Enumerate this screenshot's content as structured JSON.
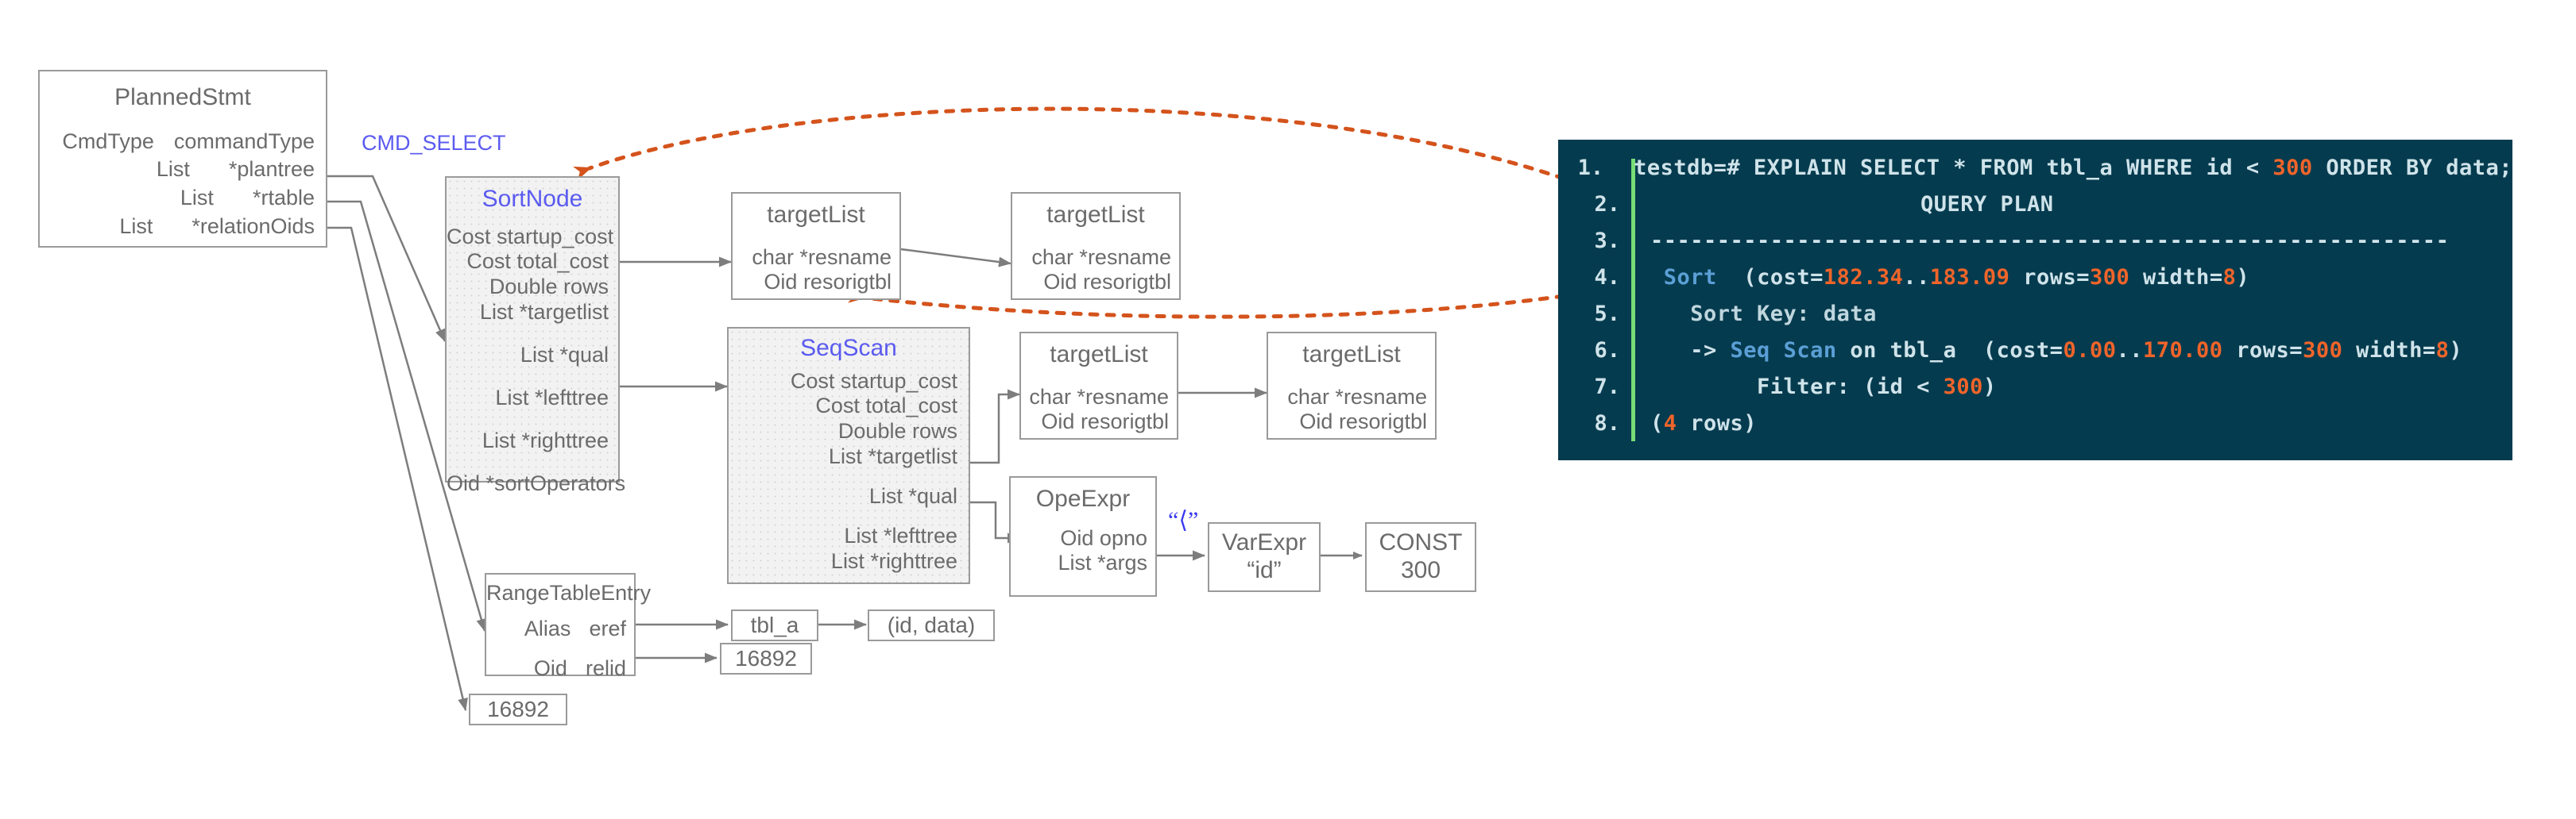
{
  "diagram": {
    "cmd_label": "CMD_SELECT",
    "operator_label": "“⟨”"
  },
  "planned_stmt": {
    "title": "PlannedStmt",
    "fields": [
      {
        "type": "CmdType",
        "name": "commandType"
      },
      {
        "type": "List",
        "name": "*plantree"
      },
      {
        "type": "List",
        "name": "*rtable"
      },
      {
        "type": "List",
        "name": "*relationOids"
      }
    ]
  },
  "sort_node": {
    "title": "SortNode",
    "fields": [
      "Cost startup_cost",
      "Cost total_cost",
      "Double rows",
      "List *targetlist",
      "List *qual",
      "List *lefttree",
      "List *righttree",
      "Oid *sortOperators"
    ]
  },
  "seq_scan": {
    "title": "SeqScan",
    "fields": [
      "Cost startup_cost",
      "Cost total_cost",
      "Double rows",
      "List *targetlist",
      "List *qual",
      "List *lefttree",
      "List *righttree"
    ]
  },
  "target_lists": [
    {
      "title": "targetList",
      "fields": [
        "char *resname",
        "Oid resorigtbl"
      ]
    },
    {
      "title": "targetList",
      "fields": [
        "char *resname",
        "Oid resorigtbl"
      ]
    },
    {
      "title": "targetList",
      "fields": [
        "char *resname",
        "Oid resorigtbl"
      ]
    },
    {
      "title": "targetList",
      "fields": [
        "char *resname",
        "Oid resorigtbl"
      ]
    }
  ],
  "ope_expr": {
    "title": "OpeExpr",
    "fields": [
      "Oid opno",
      "List *args"
    ]
  },
  "var_expr": {
    "title": "VarExpr",
    "value": "“id”"
  },
  "const_node": {
    "title": "CONST",
    "value": "300"
  },
  "range_table_entry": {
    "title": "RangeTableEntry",
    "fields": [
      {
        "type": "Alias",
        "name": "eref"
      },
      {
        "type": "Oid",
        "name": "relid"
      }
    ]
  },
  "leaf_values": {
    "table_name": "tbl_a",
    "columns": "(id, data)",
    "relid_oid": "16892",
    "relation_oid": "16892"
  },
  "terminal": {
    "lines": [
      {
        "num": "1.",
        "segments": [
          {
            "t": "testdb=# EXPLAIN SELECT * FROM tbl_a WHERE id < ",
            "c": "plain"
          },
          {
            "t": "300",
            "c": "num"
          },
          {
            "t": " ORDER BY data;",
            "c": "plain"
          }
        ]
      },
      {
        "num": "2.",
        "indent": 340,
        "segments": [
          {
            "t": "QUERY PLAN",
            "c": "plain"
          }
        ]
      },
      {
        "num": "3.",
        "segments": [
          {
            "t": "------------------------------------------------------------",
            "c": "plain"
          }
        ]
      },
      {
        "num": "4.",
        "segments": [
          {
            "t": " ",
            "c": "plain"
          },
          {
            "t": "Sort",
            "c": "kw"
          },
          {
            "t": "  (cost=",
            "c": "plain"
          },
          {
            "t": "182.34",
            "c": "num"
          },
          {
            "t": "..",
            "c": "plain"
          },
          {
            "t": "183.09",
            "c": "num"
          },
          {
            "t": " rows=",
            "c": "plain"
          },
          {
            "t": "300",
            "c": "num"
          },
          {
            "t": " width=",
            "c": "plain"
          },
          {
            "t": "8",
            "c": "num"
          },
          {
            "t": ")",
            "c": "plain"
          }
        ]
      },
      {
        "num": "5.",
        "segments": [
          {
            "t": "   Sort Key: data",
            "c": "dim"
          }
        ]
      },
      {
        "num": "6.",
        "segments": [
          {
            "t": "   -> ",
            "c": "plain"
          },
          {
            "t": "Seq Scan",
            "c": "kw"
          },
          {
            "t": " on tbl_a  (cost=",
            "c": "plain"
          },
          {
            "t": "0.00",
            "c": "num"
          },
          {
            "t": "..",
            "c": "plain"
          },
          {
            "t": "170.00",
            "c": "num"
          },
          {
            "t": " rows=",
            "c": "plain"
          },
          {
            "t": "300",
            "c": "num"
          },
          {
            "t": " width=",
            "c": "plain"
          },
          {
            "t": "8",
            "c": "num"
          },
          {
            "t": ")",
            "c": "plain"
          }
        ]
      },
      {
        "num": "7.",
        "segments": [
          {
            "t": "        Filter: (id < ",
            "c": "plain"
          },
          {
            "t": "300",
            "c": "num"
          },
          {
            "t": ")",
            "c": "plain"
          }
        ]
      },
      {
        "num": "8.",
        "segments": [
          {
            "t": "(",
            "c": "plain"
          },
          {
            "t": "4",
            "c": "num"
          },
          {
            "t": " rows)",
            "c": "plain"
          }
        ]
      }
    ]
  },
  "colors": {
    "terminal_bg": "#053b4e",
    "terminal_text": "#cfe3ea",
    "terminal_number": "#f0642a",
    "terminal_keyword": "#5b9fd6",
    "gutter_green": "#77dd77",
    "annotation_orange": "#e0541a",
    "node_accent_blue": "#5b5bf0",
    "box_border": "#9a9a9a",
    "box_text": "#6b6b6b"
  }
}
